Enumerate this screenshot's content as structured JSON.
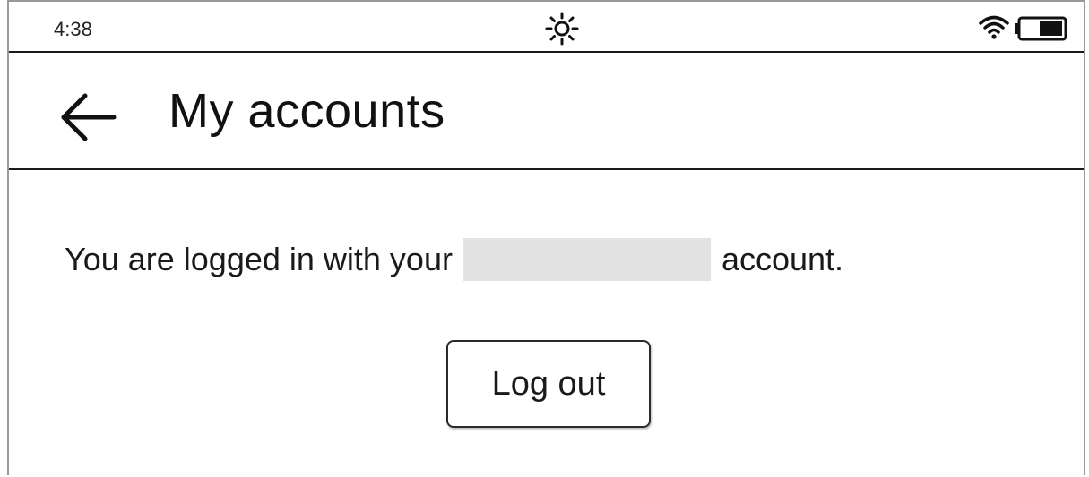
{
  "status_bar": {
    "time": "4:38",
    "brightness_icon": "sun-icon",
    "wifi_icon": "wifi-icon",
    "battery_icon": "battery-icon"
  },
  "header": {
    "back_icon": "arrow-left-icon",
    "title": "My accounts"
  },
  "main": {
    "message_prefix": "You are logged in with your",
    "message_suffix": "account.",
    "logout_label": "Log out"
  },
  "colors": {
    "text": "#111111",
    "divider": "#1a1a1a",
    "redaction": "#e2e2e2"
  }
}
